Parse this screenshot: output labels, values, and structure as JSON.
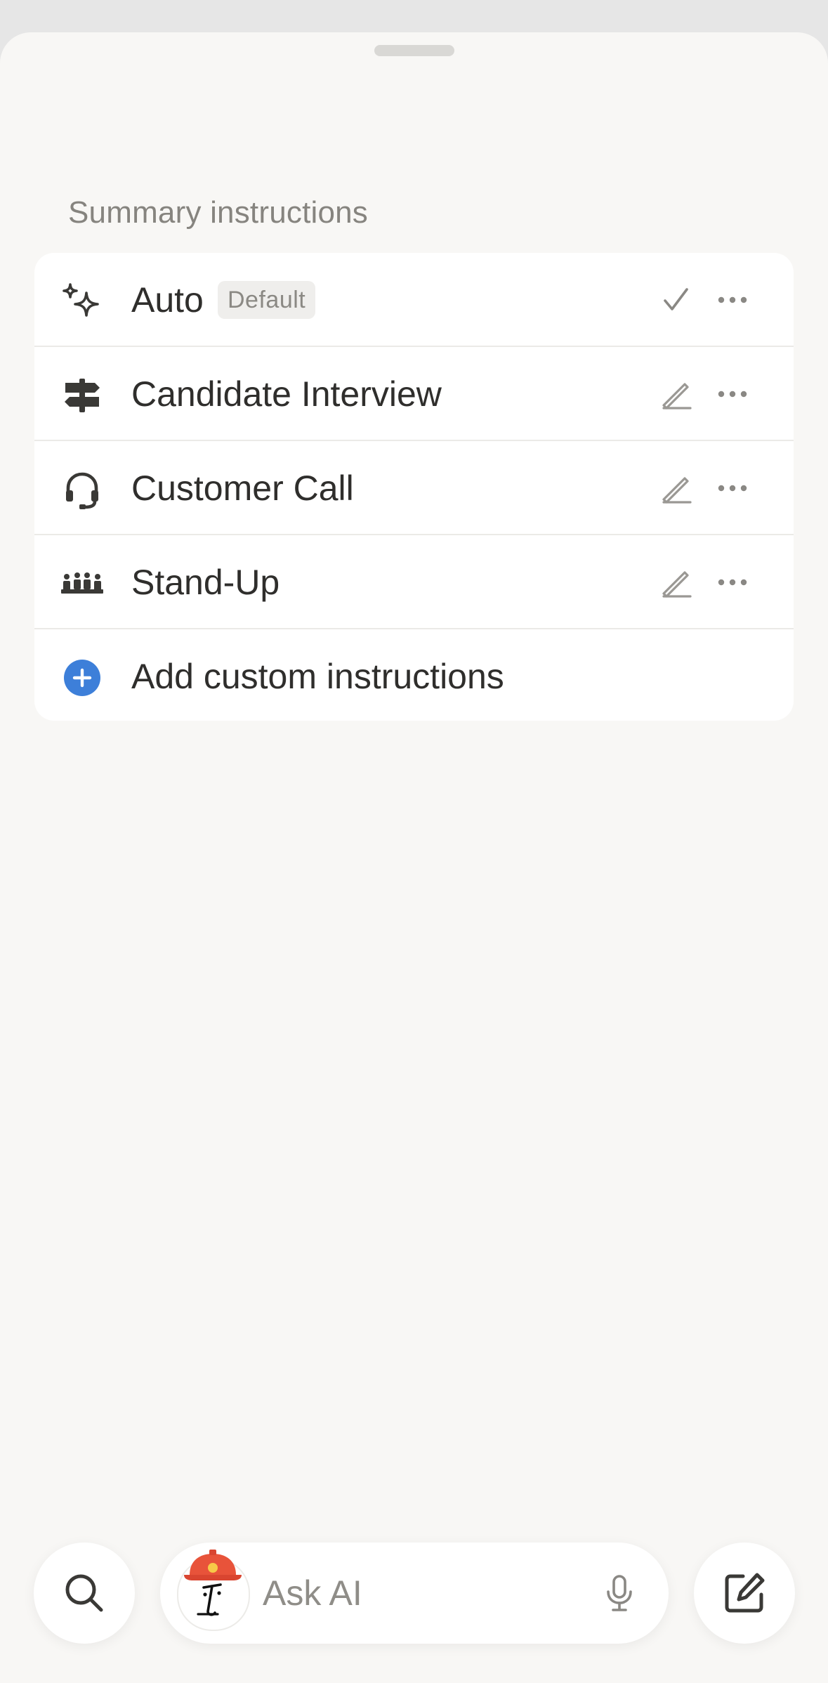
{
  "sheet": {
    "section_title": "Summary instructions"
  },
  "instructions": {
    "items": [
      {
        "label": "Auto",
        "badge": "Default",
        "icon": "sparkles-icon",
        "action": "check-icon"
      },
      {
        "label": "Candidate Interview",
        "icon": "signpost-icon",
        "action": "pencil-icon"
      },
      {
        "label": "Customer Call",
        "icon": "headset-icon",
        "action": "pencil-icon"
      },
      {
        "label": "Stand-Up",
        "icon": "team-icon",
        "action": "pencil-icon"
      }
    ],
    "add_label": "Add custom instructions",
    "add_icon": "plus-circle-icon"
  },
  "bottom_bar": {
    "search_icon": "search-icon",
    "ask_placeholder": "Ask AI",
    "avatar_icon": "ai-avatar-icon",
    "mic_icon": "microphone-icon",
    "compose_icon": "compose-icon"
  },
  "colors": {
    "accent": "#3d7fd9",
    "text": "#2f2e2c",
    "muted": "#86847f",
    "background": "#f8f7f5",
    "card": "#ffffff"
  }
}
